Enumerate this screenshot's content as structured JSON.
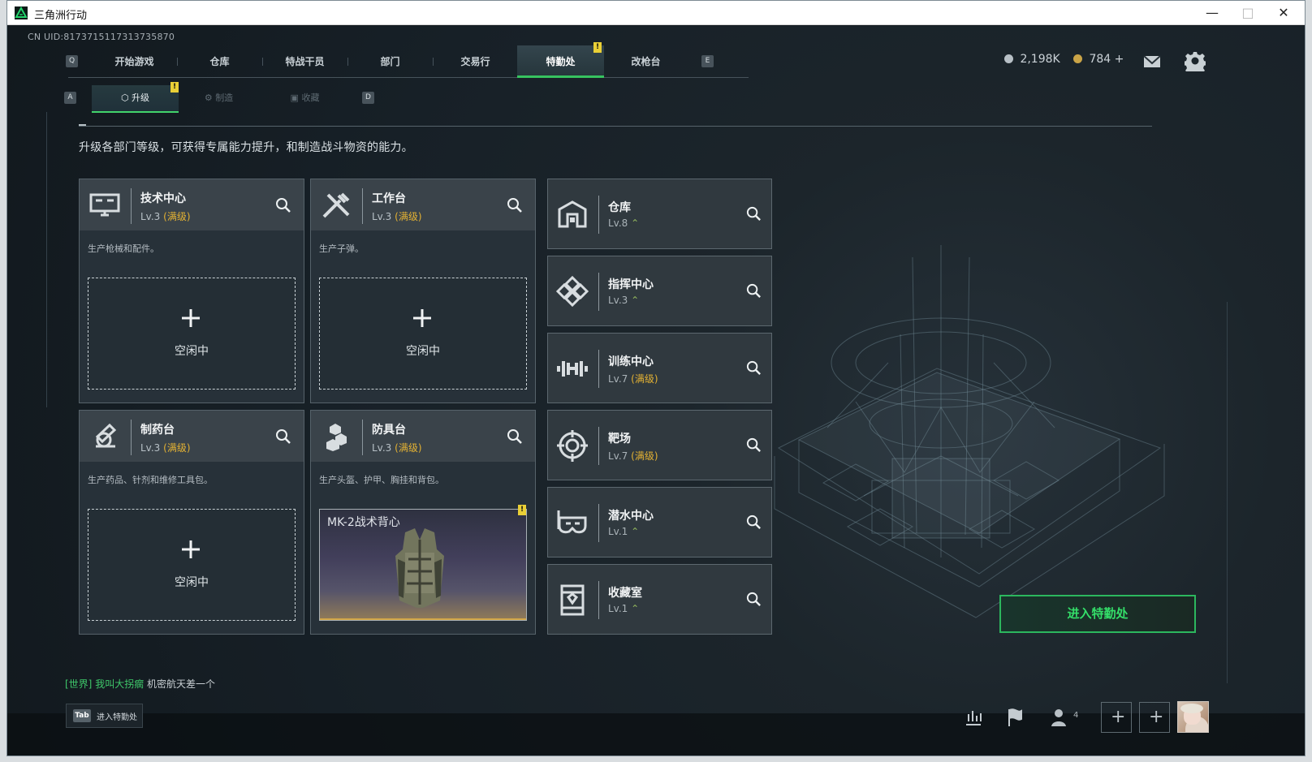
{
  "window": {
    "title": "三角洲行动",
    "minimize": "—",
    "maximize": "□",
    "close": "✕"
  },
  "header": {
    "uid": "CN UID:8173715117313735870",
    "key_left": "Q",
    "key_right": "E",
    "top_tabs": [
      {
        "label": "开始游戏"
      },
      {
        "label": "仓库"
      },
      {
        "label": "特战干员"
      },
      {
        "label": "部门"
      },
      {
        "label": "交易行"
      },
      {
        "label": "特勤处"
      },
      {
        "label": "改枪台"
      }
    ],
    "notice": "!",
    "currencies": [
      {
        "value": "2,198K",
        "icon": "silver-coin-icon"
      },
      {
        "value": "784 +",
        "icon": "gold-coin-icon"
      }
    ]
  },
  "subnav": {
    "key_left": "A",
    "key_right": "D",
    "tabs": [
      {
        "label": "升级",
        "icon": "upgrade-icon"
      },
      {
        "label": "制造",
        "icon": "craft-icon"
      },
      {
        "label": "收藏",
        "icon": "collection-icon"
      }
    ],
    "notice": "!"
  },
  "page": {
    "description": "升级各部门等级，可获得专属能力提升，和制造战斗物资的能力。",
    "enter_button": "进入特勤处"
  },
  "departments": [
    {
      "title": "技术中心",
      "level": "Lv.3",
      "max": "(满级)",
      "description": "生产枪械和配件。",
      "slot_label": "空闲中",
      "icon": "computer-icon"
    },
    {
      "title": "工作台",
      "level": "Lv.3",
      "max": "(满级)",
      "description": "生产子弹。",
      "slot_label": "空闲中",
      "icon": "tools-icon"
    },
    {
      "title": "制药台",
      "level": "Lv.3",
      "max": "(满级)",
      "description": "生产药品、针剂和维修工具包。",
      "slot_label": "空闲中",
      "icon": "pharmacy-icon"
    },
    {
      "title": "防具台",
      "level": "Lv.3",
      "max": "(满级)",
      "description": "生产头盔、护甲、胸挂和背包。",
      "item_name": "MK-2战术背心",
      "item_notice": "!",
      "icon": "armor-icon"
    }
  ],
  "facilities": [
    {
      "title": "仓库",
      "level": "Lv.8",
      "max": "",
      "icon": "warehouse-icon"
    },
    {
      "title": "指挥中心",
      "level": "Lv.3",
      "max": "",
      "icon": "command-center-icon"
    },
    {
      "title": "训练中心",
      "level": "Lv.7",
      "max": "(满级)",
      "icon": "training-icon"
    },
    {
      "title": "靶场",
      "level": "Lv.7",
      "max": "(满级)",
      "icon": "target-range-icon"
    },
    {
      "title": "潜水中心",
      "level": "Lv.1",
      "max": "",
      "icon": "diving-mask-icon"
    },
    {
      "title": "收藏室",
      "level": "Lv.1",
      "max": "",
      "icon": "collection-room-icon"
    }
  ],
  "chat": {
    "channel": "[世界]",
    "speaker": "我叫大拐瘸",
    "message": "机密航天差一个"
  },
  "footer": {
    "tab_key": "Tab",
    "tab_label": "进入特勤处",
    "friends_count": "4",
    "plus": "+"
  }
}
